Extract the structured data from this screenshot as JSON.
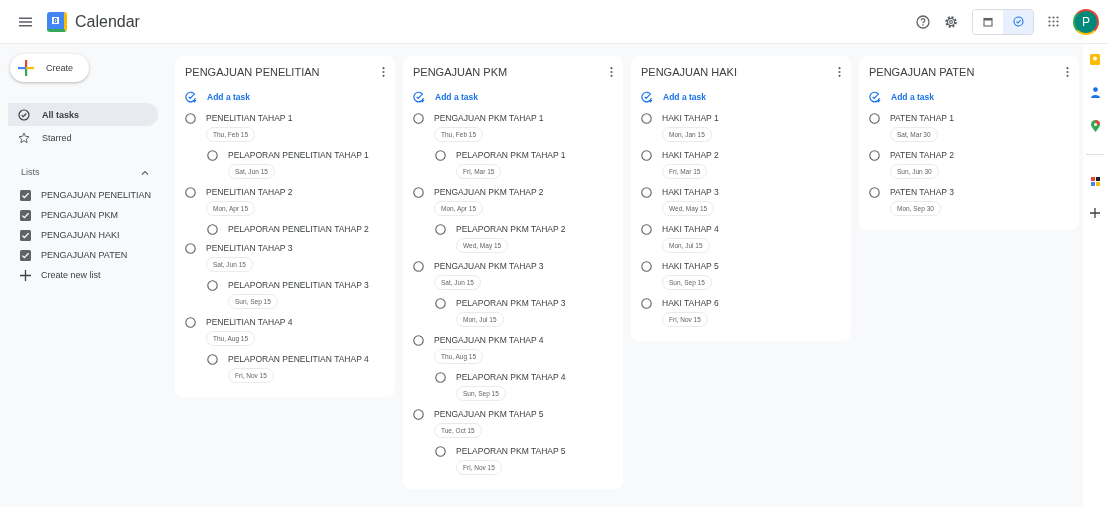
{
  "header": {
    "logo_number": "8",
    "app_title": "Calendar",
    "views": [
      {
        "kind": "calendar",
        "selected": false
      },
      {
        "kind": "tasks",
        "selected": true
      }
    ],
    "avatar_letter": "P"
  },
  "sidebar": {
    "create_label": "Create",
    "nav": [
      {
        "kind": "all",
        "label": "All tasks",
        "selected": true
      },
      {
        "kind": "starred",
        "label": "Starred",
        "selected": false
      }
    ],
    "lists_heading": "Lists",
    "lists_expanded": true,
    "lists": [
      {
        "label": "PENGAJUAN PENELITIAN",
        "checked": true
      },
      {
        "label": "PENGAJUAN PKM",
        "checked": true
      },
      {
        "label": "PENGAJUAN HAKI",
        "checked": true
      },
      {
        "label": "PENGAJUAN PATEN",
        "checked": true
      }
    ],
    "create_list_label": "Create new list"
  },
  "columns": [
    {
      "title": "PENGAJUAN PENELITIAN",
      "add_label": "Add a task",
      "tasks": [
        {
          "title": "PENELITIAN TAHAP 1",
          "date": "Thu, Feb 15",
          "completed": false,
          "children": [
            {
              "title": "PELAPORAN PENELITIAN TAHAP 1",
              "date": "Sat, Jun 15",
              "completed": false
            }
          ]
        },
        {
          "title": "PENELITIAN TAHAP 2",
          "date": "Mon, Apr 15",
          "completed": false,
          "children": [
            {
              "title": "PELAPORAN PENELITIAN TAHAP 2",
              "completed": false
            }
          ]
        },
        {
          "title": "PENELITIAN TAHAP 3",
          "date": "Sat, Jun 15",
          "completed": false,
          "children": [
            {
              "title": "PELAPORAN PENELITIAN TAHAP 3",
              "date": "Sun, Sep 15",
              "completed": false
            }
          ]
        },
        {
          "title": "PENELITIAN TAHAP 4",
          "date": "Thu, Aug 15",
          "completed": false,
          "children": [
            {
              "title": "PELAPORAN PENELITIAN TAHAP 4",
              "date": "Fri, Nov 15",
              "completed": false
            }
          ]
        }
      ]
    },
    {
      "title": "PENGAJUAN PKM",
      "add_label": "Add a task",
      "tasks": [
        {
          "title": "PENGAJUAN PKM TAHAP 1",
          "date": "Thu, Feb 15",
          "completed": false,
          "children": [
            {
              "title": "PELAPORAN PKM TAHAP 1",
              "date": "Fri, Mar 15",
              "completed": false
            }
          ]
        },
        {
          "title": "PENGAJUAN PKM TAHAP 2",
          "date": "Mon, Apr 15",
          "completed": false,
          "children": [
            {
              "title": "PELAPORAN PKM TAHAP 2",
              "date": "Wed, May 15",
              "completed": false
            }
          ]
        },
        {
          "title": "PENGAJUAN PKM TAHAP 3",
          "date": "Sat, Jun 15",
          "completed": false,
          "children": [
            {
              "title": "PELAPORAN PKM TAHAP 3",
              "date": "Mon, Jul 15",
              "completed": false
            }
          ]
        },
        {
          "title": "PENGAJUAN PKM TAHAP 4",
          "date": "Thu, Aug 15",
          "completed": false,
          "children": [
            {
              "title": "PELAPORAN PKM TAHAP 4",
              "date": "Sun, Sep 15",
              "completed": false
            }
          ]
        },
        {
          "title": "PENGAJUAN PKM TAHAP 5",
          "date": "Tue, Oct 15",
          "completed": false,
          "children": [
            {
              "title": "PELAPORAN PKM TAHAP 5",
              "date": "Fri, Nov 15",
              "completed": false
            }
          ]
        }
      ]
    },
    {
      "title": "PENGAJUAN HAKI",
      "add_label": "Add a task",
      "tasks": [
        {
          "title": "HAKI TAHAP 1",
          "date": "Mon, Jan 15",
          "completed": false
        },
        {
          "title": "HAKI TAHAP 2",
          "date": "Fri, Mar 15",
          "completed": false
        },
        {
          "title": "HAKI TAHAP 3",
          "date": "Wed, May 15",
          "completed": false
        },
        {
          "title": "HAKI TAHAP 4",
          "date": "Mon, Jul 15",
          "completed": false
        },
        {
          "title": "HAKI TAHAP 5",
          "date": "Sun, Sep 15",
          "completed": false
        },
        {
          "title": "HAKI TAHAP 6",
          "date": "Fri, Nov 15",
          "completed": false
        }
      ]
    },
    {
      "title": "PENGAJUAN PATEN",
      "add_label": "Add a task",
      "tasks": [
        {
          "title": "PATEN TAHAP 1",
          "date": "Sat, Mar 30",
          "completed": false
        },
        {
          "title": "PATEN TAHAP 2",
          "date": "Sun, Jun 30",
          "completed": false
        },
        {
          "title": "PATEN TAHAP 3",
          "date": "Mon, Sep 30",
          "completed": false
        }
      ]
    }
  ]
}
